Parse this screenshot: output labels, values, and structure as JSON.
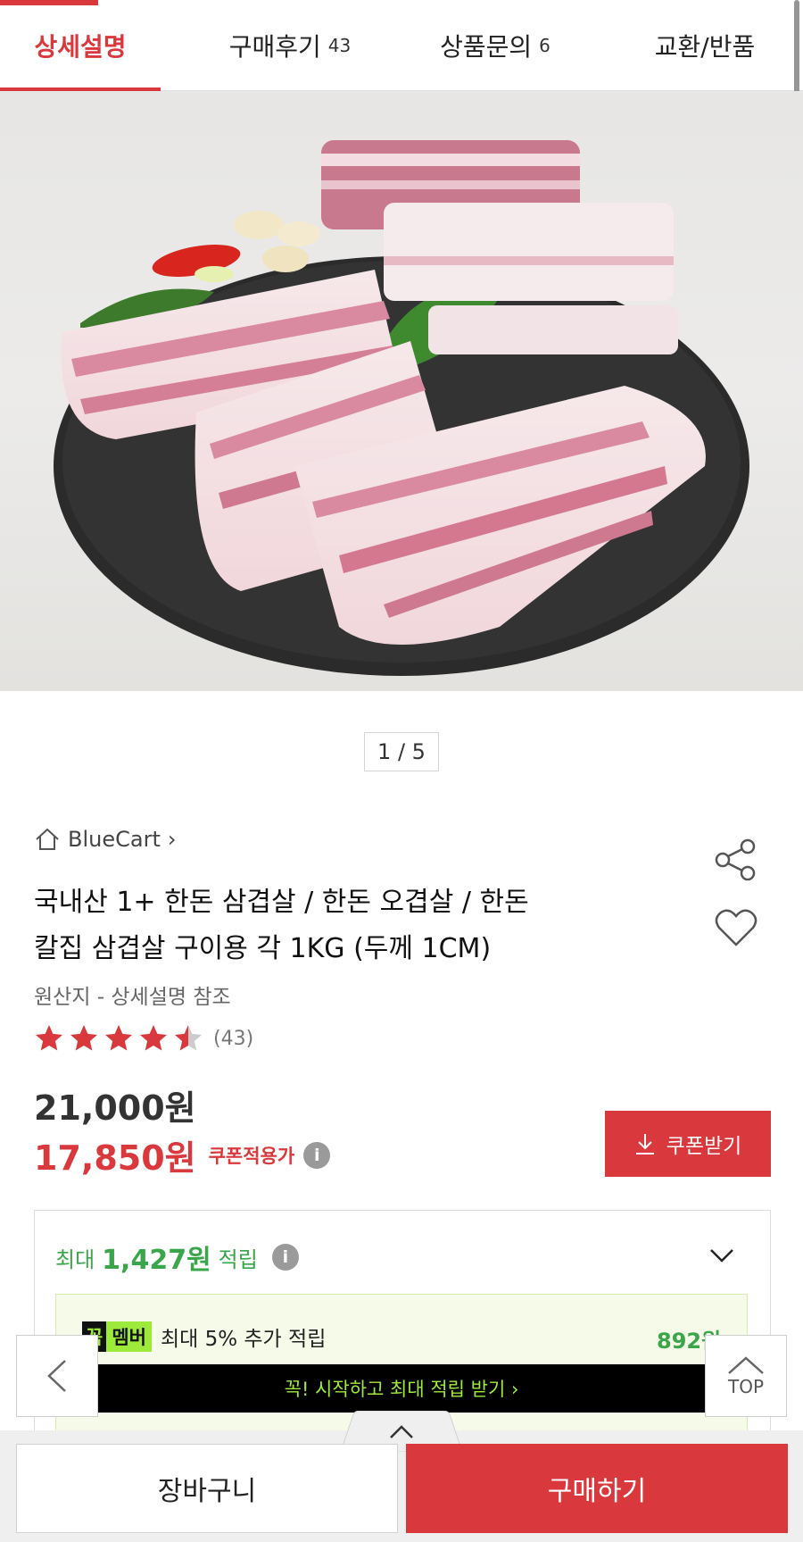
{
  "tabs": [
    {
      "label": "상세설명",
      "count": ""
    },
    {
      "label": "구매후기",
      "count": "43"
    },
    {
      "label": "상품문의",
      "count": "6"
    },
    {
      "label": "교환/반품",
      "count": ""
    }
  ],
  "pager": "1 / 5",
  "brand": {
    "name": "BlueCart",
    "chevron": "›"
  },
  "product": {
    "title_line1": "국내산 1+ 한돈 삼겹살 / 한돈 오겹살 / 한돈",
    "title_line2": "칼집 삼겹살 구이용 각 1KG (두께 1CM)",
    "origin": "원산지 - 상세설명 참조",
    "rating": 4.5,
    "review_count": "(43)"
  },
  "price": {
    "original": "21,000원",
    "sale": "17,850원",
    "sale_label": "쿠폰적용가",
    "info": "i"
  },
  "coupon_button": "쿠폰받기",
  "points": {
    "prefix": "최대",
    "amount": "1,427원",
    "suffix": "적립",
    "info": "i"
  },
  "member": {
    "badge_k": "꼭",
    "badge_m": "멤버",
    "text": "최대 5% 추가 적립",
    "amount": "892원"
  },
  "start_banner": "꼭! 시작하고 최대 적립 받기  ›",
  "nav": {
    "top_label": "TOP"
  },
  "bottom": {
    "cart": "장바구니",
    "buy": "구매하기"
  },
  "colors": {
    "accent": "#d9383d",
    "green": "#3aa64a",
    "lime": "#9eea3b"
  },
  "icons": [
    "home-icon",
    "share-icon",
    "heart-icon",
    "star-icon",
    "info-icon",
    "download-icon",
    "chevron-down-icon",
    "chevron-left-icon",
    "chevron-up-icon"
  ]
}
